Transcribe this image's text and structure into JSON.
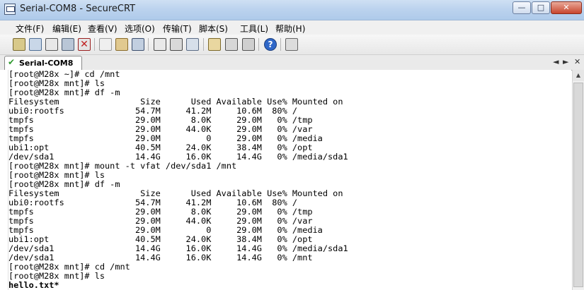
{
  "window": {
    "title": "Serial-COM8 - SecureCRT",
    "controls": {
      "minimize": "—",
      "maximize": "□",
      "close": "✕"
    }
  },
  "menu": {
    "items": [
      "文件(F)",
      "编辑(E)",
      "查看(V)",
      "选项(O)",
      "传输(T)",
      "脚本(S)",
      "工具(L)",
      "帮助(H)"
    ]
  },
  "toolbar": {
    "icons": [
      "connect-icon",
      "quick-connect-icon",
      "connect-in-tab-icon",
      "reconnect-icon",
      "disconnect-icon",
      "copy-icon",
      "paste-icon",
      "find-icon",
      "print-icon",
      "print-setup-icon",
      "sftp-icon",
      "session-options-icon",
      "global-options-icon",
      "keymap-icon",
      "help-icon",
      "about-icon"
    ]
  },
  "tabs": [
    {
      "label": "Serial-COM8",
      "active": true
    }
  ],
  "tab_nav": {
    "prev": "◄",
    "next": "►",
    "close": "✕"
  },
  "terminal": {
    "lines": [
      "[root@M28x ~]# cd /mnt",
      "[root@M28x mnt]# ls",
      "[root@M28x mnt]# df -m",
      "Filesystem                Size      Used Available Use% Mounted on",
      "ubi0:rootfs              54.7M     41.2M     10.6M  80% /",
      "tmpfs                    29.0M      8.0K     29.0M   0% /tmp",
      "tmpfs                    29.0M     44.0K     29.0M   0% /var",
      "tmpfs                    29.0M         0     29.0M   0% /media",
      "ubi1:opt                 40.5M     24.0K     38.4M   0% /opt",
      "/dev/sda1                14.4G     16.0K     14.4G   0% /media/sda1",
      "[root@M28x mnt]# mount -t vfat /dev/sda1 /mnt",
      "[root@M28x mnt]# ls",
      "[root@M28x mnt]# df -m",
      "Filesystem                Size      Used Available Use% Mounted on",
      "ubi0:rootfs              54.7M     41.2M     10.6M  80% /",
      "tmpfs                    29.0M      8.0K     29.0M   0% /tmp",
      "tmpfs                    29.0M     44.0K     29.0M   0% /var",
      "tmpfs                    29.0M         0     29.0M   0% /media",
      "ubi1:opt                 40.5M     24.0K     38.4M   0% /opt",
      "/dev/sda1                14.4G     16.0K     14.4G   0% /media/sda1",
      "/dev/sda1                14.4G     16.0K     14.4G   0% /mnt",
      "[root@M28x mnt]# cd /mnt",
      "[root@M28x mnt]# ls",
      "hello.txt*"
    ]
  },
  "colors": {
    "titlebar": "#bcd3ee",
    "terminal_bg": "#ffffff",
    "terminal_fg": "#000000",
    "tab_check": "#2f9a2f"
  }
}
